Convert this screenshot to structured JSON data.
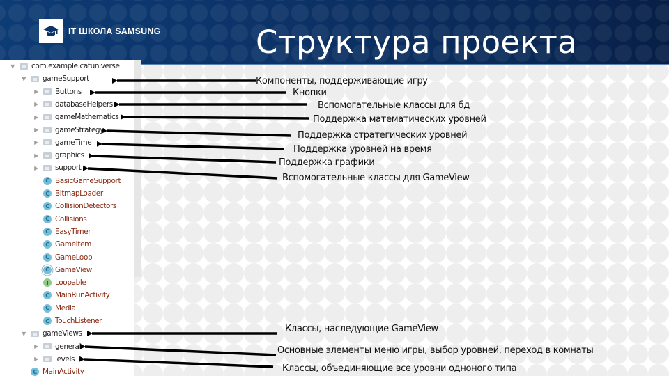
{
  "header": {
    "logo_text": "IT ШКОЛА SAMSUNG",
    "logo_icon": "graduation-cap-icon",
    "title": "Структура проекта",
    "background_color": "#0c3368"
  },
  "tree": {
    "root": {
      "label": "com.example.catuniverse",
      "icon": "folder-icon",
      "expanded": true
    },
    "items": [
      {
        "label": "gameSupport",
        "type": "package",
        "expanded": true,
        "level": 1
      },
      {
        "label": "Buttons",
        "type": "package",
        "expanded": false,
        "level": 2
      },
      {
        "label": "databaseHelpers",
        "type": "package",
        "expanded": false,
        "level": 2
      },
      {
        "label": "gameMathematics",
        "type": "package",
        "expanded": false,
        "level": 2
      },
      {
        "label": "gameStrategy",
        "type": "package",
        "expanded": false,
        "level": 2
      },
      {
        "label": "gameTime",
        "type": "package",
        "expanded": false,
        "level": 2
      },
      {
        "label": "graphics",
        "type": "package",
        "expanded": false,
        "level": 2
      },
      {
        "label": "support",
        "type": "package",
        "expanded": false,
        "level": 2
      },
      {
        "label": "BasicGameSupport",
        "type": "class",
        "level": 2
      },
      {
        "label": "BitmapLoader",
        "type": "class",
        "level": 2
      },
      {
        "label": "CollisionDetectors",
        "type": "class",
        "level": 2
      },
      {
        "label": "Collisions",
        "type": "class",
        "level": 2
      },
      {
        "label": "EasyTimer",
        "type": "class",
        "level": 2
      },
      {
        "label": "GameItem",
        "type": "class",
        "level": 2
      },
      {
        "label": "GameLoop",
        "type": "class",
        "level": 2
      },
      {
        "label": "GameView",
        "type": "abstract-class",
        "level": 2
      },
      {
        "label": "Loopable",
        "type": "interface",
        "level": 2
      },
      {
        "label": "MainRunActivity",
        "type": "class",
        "level": 2
      },
      {
        "label": "Media",
        "type": "class",
        "level": 2
      },
      {
        "label": "TouchListener",
        "type": "class",
        "level": 2
      },
      {
        "label": "gameViews",
        "type": "package",
        "expanded": true,
        "level": 1
      },
      {
        "label": "general",
        "type": "package",
        "expanded": false,
        "level": 2
      },
      {
        "label": "levels",
        "type": "package",
        "expanded": false,
        "level": 2
      },
      {
        "label": "MainActivity",
        "type": "class",
        "level": 1
      }
    ],
    "class_icon_glyph": "C",
    "interface_icon_glyph": "I",
    "class_text_color": "#8b2c14",
    "class_icon_color": "#72c0dc",
    "interface_icon_color": "#8fc98a"
  },
  "annotations": [
    {
      "target": "gameSupport",
      "text": "Компоненты, поддерживающие игру"
    },
    {
      "target": "Buttons",
      "text": "Кнопки"
    },
    {
      "target": "databaseHelpers",
      "text": "Вспомогательные классы для бд"
    },
    {
      "target": "gameMathematics",
      "text": "Поддержка математических уровней"
    },
    {
      "target": "gameStrategy",
      "text": "Поддержка стратегических уровней"
    },
    {
      "target": "gameTime",
      "text": "Поддержка уровней на время"
    },
    {
      "target": "graphics",
      "text": "Поддержка графики"
    },
    {
      "target": "support",
      "text": "Вспомогательные классы для GameView"
    },
    {
      "target": "gameViews",
      "text": "Классы, наследующие GameView"
    },
    {
      "target": "general",
      "text": "Основные элементы меню игры, выбор уровней, переход в комнаты"
    },
    {
      "target": "levels",
      "text": "Классы, объединяющие все уровни одноного типа"
    }
  ]
}
